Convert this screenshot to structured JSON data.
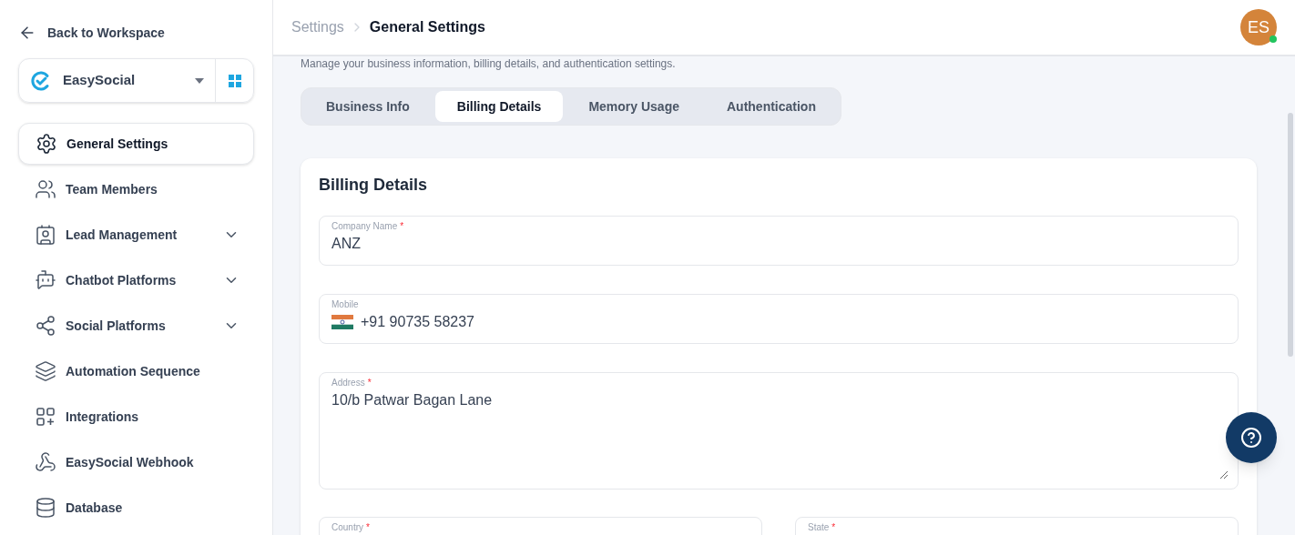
{
  "sidebar": {
    "back_link": "Back to Workspace",
    "workspace": {
      "name": "EasySocial"
    },
    "items": [
      {
        "label": "General Settings",
        "selected": true,
        "kind": "link"
      },
      {
        "label": "Team Members",
        "selected": false,
        "kind": "link"
      },
      {
        "label": "Lead Management",
        "selected": false,
        "kind": "group"
      },
      {
        "label": "Chatbot Platforms",
        "selected": false,
        "kind": "group"
      },
      {
        "label": "Social Platforms",
        "selected": false,
        "kind": "group"
      },
      {
        "label": "Automation Sequence",
        "selected": false,
        "kind": "link"
      },
      {
        "label": "Integrations",
        "selected": false,
        "kind": "link"
      },
      {
        "label": "EasySocial Webhook",
        "selected": false,
        "kind": "link"
      },
      {
        "label": "Database",
        "selected": false,
        "kind": "link"
      }
    ]
  },
  "header": {
    "breadcrumb": [
      "Settings",
      "General Settings"
    ],
    "avatar": {
      "initials": "ES",
      "online": true
    }
  },
  "subtitle": "Manage your business information, billing details, and authentication settings.",
  "tabs": [
    {
      "label": "Business Info",
      "selected": false
    },
    {
      "label": "Billing Details",
      "selected": true
    },
    {
      "label": "Memory Usage",
      "selected": false
    },
    {
      "label": "Authentication",
      "selected": false
    }
  ],
  "card": {
    "title": "Billing Details",
    "fields": [
      {
        "kind": "text",
        "label": "Company Name",
        "required_mark": "*",
        "value": "ANZ"
      },
      {
        "kind": "phone",
        "label": "Mobile",
        "value": "+91 90735 58237"
      },
      {
        "kind": "textarea",
        "label": "Address",
        "required_mark": "*",
        "value": "10/b Patwar Bagan Lane"
      }
    ],
    "row_fields": [
      {
        "label": "Country",
        "required_mark": "*"
      },
      {
        "label": "State",
        "required_mark": "*"
      }
    ]
  }
}
